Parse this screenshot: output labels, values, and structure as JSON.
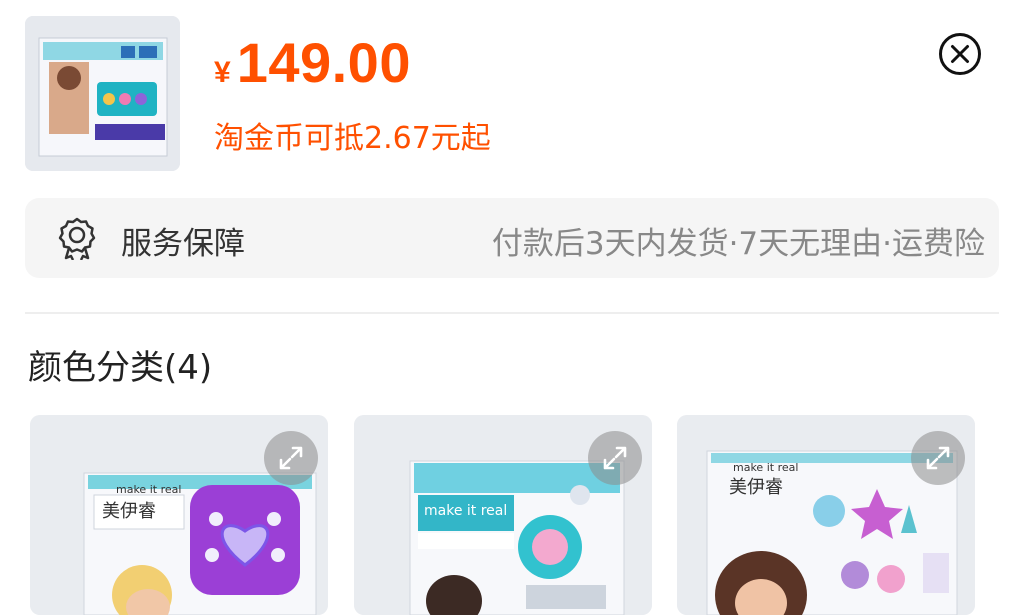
{
  "header": {
    "currency_symbol": "¥",
    "price": "149.00",
    "coin_note": "淘金币可抵2.67元起",
    "price_color": "#ff5000"
  },
  "service": {
    "label": "服务保障",
    "detail": "付款后3天内发货·7天无理由·运费险",
    "icon": "award-badge-icon"
  },
  "variants": {
    "title": "颜色分类(4)",
    "items": [
      {
        "brand_line": "make it real",
        "brand_cn": "美伊睿",
        "accent": "#9b3fd6"
      },
      {
        "brand_line": "make it real",
        "brand_cn": "",
        "accent": "#33b6c8"
      },
      {
        "brand_line": "make it real",
        "brand_cn": "美伊睿",
        "accent": "#c75fd1"
      }
    ]
  },
  "icons": {
    "close": "close-circle-icon",
    "expand": "expand-arrows-icon"
  }
}
